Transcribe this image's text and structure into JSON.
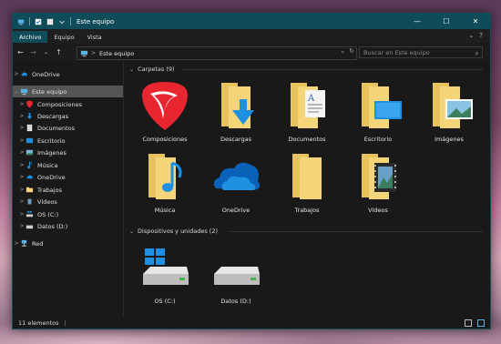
{
  "window": {
    "title": "Este equipo",
    "controls": [
      "—",
      "☐",
      "✕"
    ]
  },
  "ribbon": {
    "tabs": [
      "Archivo",
      "Equipo",
      "Vista"
    ],
    "active_tab": 0,
    "right": [
      "⌄",
      "?"
    ]
  },
  "nav": {
    "back": "←",
    "forward": "→",
    "recent": "⌄",
    "up": "↑",
    "breadcrumb": "Este equipo",
    "sep": ">",
    "dropdown": "⌄",
    "refresh": "↻",
    "search_placeholder": "Buscar en Este equipo"
  },
  "sidebar": {
    "items": [
      {
        "label": "OneDrive",
        "icon": "onedrive-cloud-icon",
        "indent": 0,
        "chevron": ">"
      },
      {
        "label": "Este equipo",
        "icon": "this-pc-icon",
        "indent": 0,
        "chevron": "⌄",
        "selected": true
      },
      {
        "label": "Composiciones",
        "icon": "red-pick-icon",
        "indent": 1,
        "chevron": ">"
      },
      {
        "label": "Descargas",
        "icon": "download-arrow-icon",
        "indent": 1,
        "chevron": ">"
      },
      {
        "label": "Documentos",
        "icon": "document-icon",
        "indent": 1,
        "chevron": ">"
      },
      {
        "label": "Escritorio",
        "icon": "desktop-icon",
        "indent": 1,
        "chevron": ">"
      },
      {
        "label": "Imágenes",
        "icon": "pictures-icon",
        "indent": 1,
        "chevron": ">"
      },
      {
        "label": "Música",
        "icon": "music-note-icon",
        "indent": 1,
        "chevron": ">"
      },
      {
        "label": "OneDrive",
        "icon": "onedrive-cloud-icon",
        "indent": 1,
        "chevron": ">"
      },
      {
        "label": "Trabajos",
        "icon": "folder-icon",
        "indent": 1,
        "chevron": ">"
      },
      {
        "label": "Vídeos",
        "icon": "video-film-icon",
        "indent": 1,
        "chevron": ">"
      },
      {
        "label": "OS (C:)",
        "icon": "windows-drive-icon",
        "indent": 1,
        "chevron": ">"
      },
      {
        "label": "Datos (D:)",
        "icon": "hard-drive-icon",
        "indent": 1,
        "chevron": ">"
      },
      {
        "label": "Red",
        "icon": "network-icon",
        "indent": 0,
        "chevron": ">"
      }
    ]
  },
  "content": {
    "folders_header": "Carpetas (9)",
    "devices_header": "Dispositivos y unidades (2)",
    "folders": [
      {
        "label": "Composiciones",
        "icon": "red-pick-icon"
      },
      {
        "label": "Descargas",
        "icon": "folder-download-icon"
      },
      {
        "label": "Documentos",
        "icon": "folder-documents-icon"
      },
      {
        "label": "Escritorio",
        "icon": "folder-desktop-icon"
      },
      {
        "label": "Imágenes",
        "icon": "folder-pictures-icon"
      },
      {
        "label": "Música",
        "icon": "folder-music-icon"
      },
      {
        "label": "OneDrive",
        "icon": "onedrive-cloud-icon"
      },
      {
        "label": "Trabajos",
        "icon": "folder-icon"
      },
      {
        "label": "Vídeos",
        "icon": "folder-videos-icon"
      }
    ],
    "devices": [
      {
        "label": "OS (C:)",
        "icon": "windows-drive-icon"
      },
      {
        "label": "Datos (D:)",
        "icon": "hard-drive-icon"
      }
    ]
  },
  "status": {
    "count": "11 elementos",
    "sep": "|"
  },
  "colors": {
    "titlebar": "#0f4b58",
    "window_bg": "#191919",
    "selected_row": "#555555",
    "folder": "#f5d57a",
    "accent_blue": "#1e8fe1",
    "pick_red": "#e8262f"
  }
}
